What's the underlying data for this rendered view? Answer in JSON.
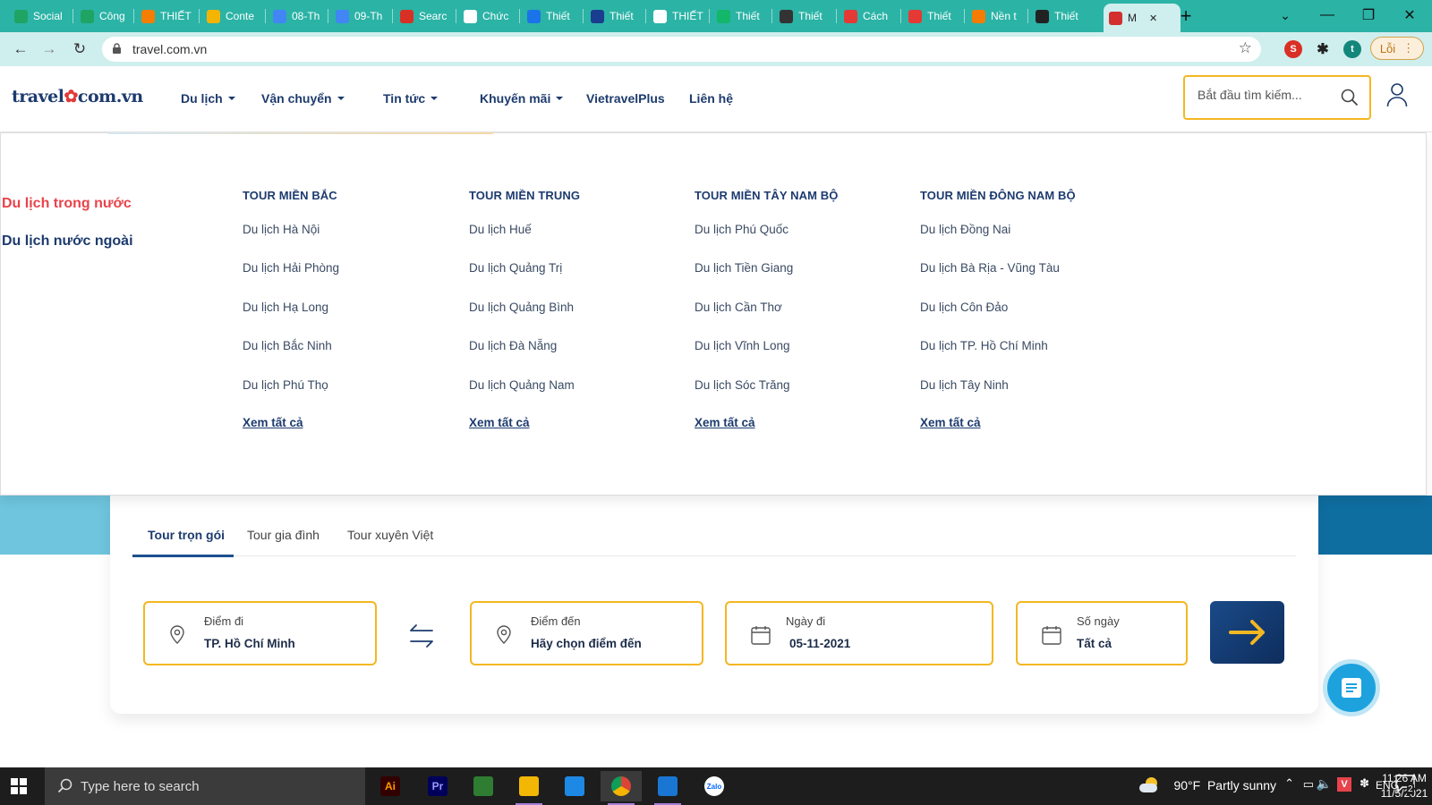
{
  "browser": {
    "tabs": [
      {
        "label": "Social",
        "icon": "plus-green-icon",
        "color": "#1fa463"
      },
      {
        "label": "Công",
        "icon": "plus-green-icon",
        "color": "#1fa463"
      },
      {
        "label": "THIẾT",
        "icon": "blogger-icon",
        "color": "#f57d00"
      },
      {
        "label": "Conte",
        "icon": "drive-icon",
        "color": "#f4b400"
      },
      {
        "label": "08-Th",
        "icon": "docs-icon",
        "color": "#4285f4"
      },
      {
        "label": "09-Th",
        "icon": "docs-icon",
        "color": "#4285f4"
      },
      {
        "label": "Searc",
        "icon": "pen-icon",
        "color": "#d93025"
      },
      {
        "label": "Chức",
        "icon": "google-icon",
        "color": "#ffffff"
      },
      {
        "label": "Thiết",
        "icon": "b-icon",
        "color": "#1a73e8"
      },
      {
        "label": "Thiết",
        "icon": "paper-plane-icon",
        "color": "#1a3d8f"
      },
      {
        "label": "THIẾT",
        "icon": "arrow-icon",
        "color": "#ffffff"
      },
      {
        "label": "Thiết",
        "icon": "s-icon",
        "color": "#12b76a"
      },
      {
        "label": "Thiết",
        "icon": "eyes-icon",
        "color": "#333333"
      },
      {
        "label": "Cách",
        "icon": "c-red-icon",
        "color": "#e53935"
      },
      {
        "label": "Thiết",
        "icon": "w-icon",
        "color": "#e53935"
      },
      {
        "label": "Nền t",
        "icon": "leaf-icon",
        "color": "#f57c00"
      },
      {
        "label": "Thiết",
        "icon": "globe-icon",
        "color": "#222222"
      },
      {
        "label": "M",
        "icon": "vietravel-icon",
        "color": "#d32f2f",
        "active": true
      }
    ],
    "new_tab": "+",
    "url": "travel.com.vn",
    "profile_initial": "t",
    "error_label": "Lỗi"
  },
  "site": {
    "logo_left": "travel",
    "logo_right": "com.vn",
    "nav": [
      {
        "label": "Du lịch",
        "caret": true
      },
      {
        "label": "Vận chuyển",
        "caret": true
      },
      {
        "label": "Tin tức",
        "caret": true
      },
      {
        "label": "Khuyến mãi",
        "caret": true
      },
      {
        "label": "VietravelPlus",
        "caret": false
      },
      {
        "label": "Liên hệ",
        "caret": false
      }
    ],
    "search_placeholder": "Bắt đầu tìm kiếm...",
    "accent": "#f3b722",
    "brand": "#1d3b6e",
    "highlight": "#e8434b"
  },
  "menu": {
    "categories": [
      "Du lịch trong nước",
      "Du lịch nước ngoài"
    ],
    "columns": [
      {
        "title": "TOUR MIỀN BẮC",
        "items": [
          "Du lịch Hà Nội",
          "Du lịch Hải Phòng",
          "Du lịch Hạ Long",
          "Du lịch Bắc Ninh",
          "Du lịch Phú Thọ"
        ],
        "more": "Xem tất cả"
      },
      {
        "title": "TOUR MIỀN TRUNG",
        "items": [
          "Du lịch Huế",
          "Du lịch Quảng Trị",
          "Du lịch Quảng Bình",
          "Du lịch Đà Nẵng",
          "Du lịch Quảng Nam"
        ],
        "more": "Xem tất cả"
      },
      {
        "title": "TOUR MIỀN TÂY NAM BỘ",
        "items": [
          "Du lịch Phú Quốc",
          "Du lịch Tiền Giang",
          "Du lịch Cần Thơ",
          "Du lịch Vĩnh Long",
          "Du lịch Sóc Trăng"
        ],
        "more": "Xem tất cả"
      },
      {
        "title": "TOUR MIỀN ĐÔNG NAM BỘ",
        "items": [
          "Du lịch Đồng Nai",
          "Du lịch Bà Rịa - Vũng Tàu",
          "Du lịch Côn Đảo",
          "Du lịch TP. Hồ Chí Minh",
          "Du lịch Tây Ninh"
        ],
        "more": "Xem tất cả"
      }
    ]
  },
  "booking": {
    "tabs": [
      "Tour trọn gói",
      "Tour gia đình",
      "Tour xuyên Việt"
    ],
    "from": {
      "label": "Điểm đi",
      "value": "TP. Hồ Chí Minh"
    },
    "to": {
      "label": "Điểm đến",
      "value": "Hãy chọn điểm đến"
    },
    "date": {
      "label": "Ngày đi",
      "value": "05-11-2021"
    },
    "days": {
      "label": "Số ngày",
      "value": "Tất cả"
    }
  },
  "taskbar": {
    "search_placeholder": "Type here to search",
    "apps": [
      {
        "name": "illustrator-icon",
        "text": "Ai"
      },
      {
        "name": "premiere-icon",
        "text": "Pr"
      },
      {
        "name": "greenshot-icon",
        "text": ""
      },
      {
        "name": "file-explorer-icon",
        "text": ""
      },
      {
        "name": "calendar-icon",
        "text": ""
      },
      {
        "name": "chrome-icon",
        "text": ""
      },
      {
        "name": "media-player-icon",
        "text": ""
      },
      {
        "name": "zalo-icon",
        "text": "Zalo"
      }
    ],
    "weather": "90°F  Partly sunny",
    "language": "ENG",
    "time": "11:26 AM",
    "date": "11/5/2021",
    "notifications": "2"
  }
}
